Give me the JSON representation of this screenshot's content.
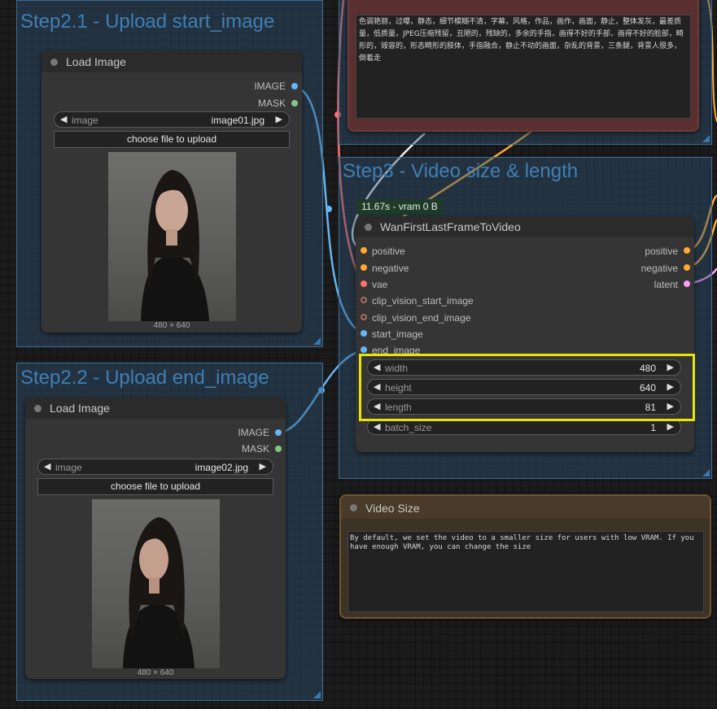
{
  "groups": {
    "step21": {
      "title": "Step2.1 - Upload start_image"
    },
    "step22": {
      "title": "Step2.2 - Upload end_image"
    },
    "step3": {
      "title": "Step3 - Video size & length"
    }
  },
  "load_image_start": {
    "title": "Load Image",
    "outputs": [
      "IMAGE",
      "MASK"
    ],
    "image_label": "image",
    "image_value": "image01.jpg",
    "upload_label": "choose file to upload",
    "caption": "480 × 640"
  },
  "load_image_end": {
    "title": "Load Image",
    "outputs": [
      "IMAGE",
      "MASK"
    ],
    "image_label": "image",
    "image_value": "image02.jpg",
    "upload_label": "choose file to upload",
    "caption": "480 × 640"
  },
  "negative_prompt": {
    "text": "色调艳丽，过曝，静态，细节模糊不清，字幕，风格，作品，画作，画面，静止，整体发灰，最差质量，低质量，JPEG压缩残留，丑陋的，残缺的，多余的手指，画得不好的手部，画得不好的脸部，畸形的，毁容的，形态畸形的肢体，手指融合，静止不动的画面，杂乱的背景，三条腿，背景人很多，倒着走"
  },
  "wan_node": {
    "timing": "11.67s - vram 0 B",
    "title": "WanFirstLastFrameToVideo",
    "inputs": [
      "positive",
      "negative",
      "vae",
      "clip_vision_start_image",
      "clip_vision_end_image",
      "start_image",
      "end_image"
    ],
    "outputs": [
      "positive",
      "negative",
      "latent"
    ],
    "widgets": [
      {
        "label": "width",
        "value": "480"
      },
      {
        "label": "height",
        "value": "640"
      },
      {
        "label": "length",
        "value": "81"
      },
      {
        "label": "batch_size",
        "value": "1"
      }
    ]
  },
  "video_size_note": {
    "title": "Video Size",
    "text": "By default, we set the video to a smaller size for users with low VRAM. If you have enough VRAM, you can change the size"
  },
  "colors": {
    "group_bg": "#30526f",
    "group_title": "#3f7fb5",
    "highlight": "#e6e600",
    "image_port": "#64b5f6",
    "mask_port": "#81c784",
    "conditioning_port": "#ffa931",
    "vae_port": "#ff6e6e",
    "latent_port": "#ff9cf9",
    "clip_vision_port": "#a8705a",
    "prompt_border": "#6b3a3a",
    "note_border": "#6b5533"
  }
}
